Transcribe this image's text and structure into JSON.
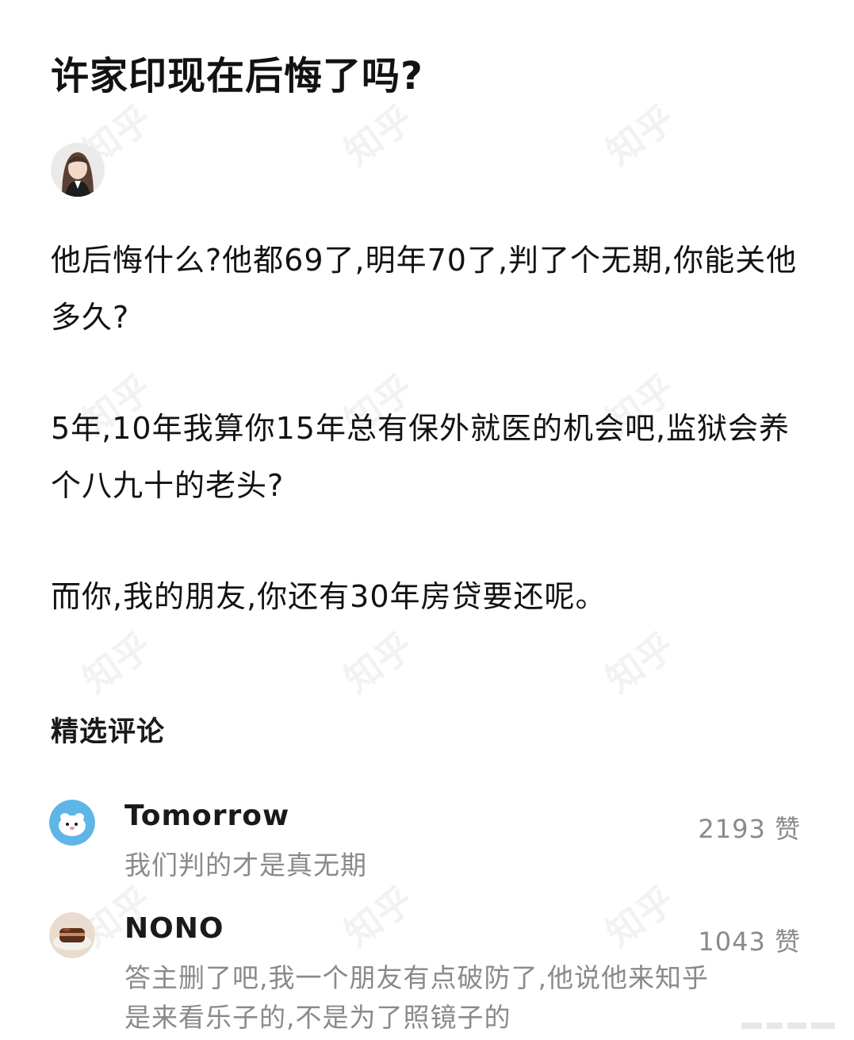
{
  "question": {
    "title": "许家印现在后悔了吗?"
  },
  "answer": {
    "paragraphs": [
      "他后悔什么?他都69了,明年70了,判了个无期,你能关他多久?",
      "5年,10年我算你15年总有保外就医的机会吧,监狱会养个八九十的老头?",
      "而你,我的朋友,你还有30年房贷要还呢。"
    ]
  },
  "comments_section": {
    "heading": "精选评论",
    "items": [
      {
        "author": "Tomorrow",
        "likes": "2193 赞",
        "text": "我们判的才是真无期"
      },
      {
        "author": "NONO",
        "likes": "1043 赞",
        "text": "答主删了吧,我一个朋友有点破防了,他说他来知乎是来看乐子的,不是为了照镜子的"
      }
    ]
  },
  "watermark": {
    "text": "知乎"
  },
  "icons": {
    "author_avatar": "user-avatar-icon",
    "comment_avatar_1": "cartoon-avatar-icon",
    "comment_avatar_2": "food-avatar-icon"
  },
  "colors": {
    "title": "#121212",
    "body_text": "#121212",
    "muted_text": "#8a8a8a",
    "avatar_blue": "#5fb6e6",
    "avatar_brown": "#5a2f1e"
  }
}
